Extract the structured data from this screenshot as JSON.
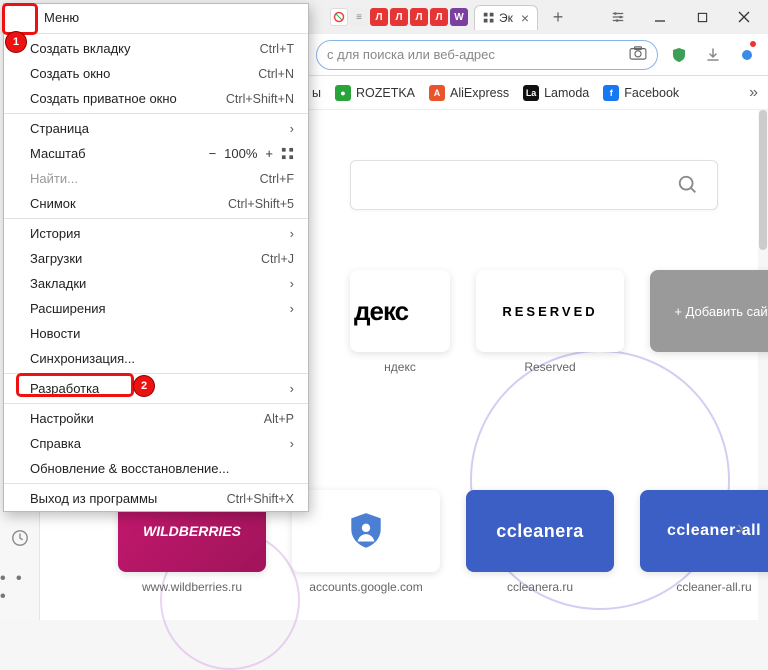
{
  "menu": {
    "title": "Меню",
    "items": [
      {
        "label": "Создать вкладку",
        "shortcut": "Ctrl+T"
      },
      {
        "label": "Создать окно",
        "shortcut": "Ctrl+N"
      },
      {
        "label": "Создать приватное окно",
        "shortcut": "Ctrl+Shift+N"
      }
    ],
    "page_item": {
      "label": "Страница"
    },
    "zoom_item": {
      "label": "Масштаб",
      "minus": "−",
      "value": "100%",
      "plus": "+"
    },
    "find_item": {
      "label": "Найти...",
      "shortcut": "Ctrl+F"
    },
    "snapshot_item": {
      "label": "Снимок",
      "shortcut": "Ctrl+Shift+5"
    },
    "history_item": {
      "label": "История"
    },
    "downloads_item": {
      "label": "Загрузки",
      "shortcut": "Ctrl+J"
    },
    "bookmarks_item": {
      "label": "Закладки"
    },
    "extensions_item": {
      "label": "Расширения"
    },
    "news_item": {
      "label": "Новости"
    },
    "sync_item": {
      "label": "Синхронизация..."
    },
    "dev_item": {
      "label": "Разработка"
    },
    "settings_item": {
      "label": "Настройки",
      "shortcut": "Alt+P"
    },
    "help_item": {
      "label": "Справка"
    },
    "update_item": {
      "label": "Обновление & восстановление..."
    },
    "exit_item": {
      "label": "Выход из программы",
      "shortcut": "Ctrl+Shift+X"
    }
  },
  "toolbar": {
    "url_placeholder": "с для поиска или веб-адрес"
  },
  "active_tab": {
    "label": "Эк"
  },
  "bookmarks": {
    "items": [
      {
        "label": "ы",
        "color": "#f0a030"
      },
      {
        "label": "ROZETKA",
        "color": "#2aa33a",
        "icon": "●"
      },
      {
        "label": "AliExpress",
        "color": "#e8542c",
        "icon": "A"
      },
      {
        "label": "Lamoda",
        "color": "#111",
        "icon": "La"
      },
      {
        "label": "Facebook",
        "color": "#1877f2",
        "icon": "f"
      }
    ]
  },
  "tiles_r1": [
    {
      "text": "декс",
      "label": "ндекс",
      "style": "yandex"
    },
    {
      "text": "RESERVED",
      "label": "Reserved",
      "style": "reserved"
    },
    {
      "text": "+ Добавить сайт",
      "label": "",
      "style": "add"
    }
  ],
  "tiles_r2": [
    {
      "text": "WILDBERRIES",
      "label": "www.wildberries.ru",
      "style": "wild"
    },
    {
      "text": "",
      "label": "accounts.google.com",
      "style": "google"
    },
    {
      "text": "ccleanera",
      "label": "ccleanera.ru",
      "style": "blue"
    },
    {
      "text": "ccleaner-all",
      "label": "ccleaner-all.ru",
      "style": "blue2"
    }
  ],
  "colors": {
    "red": "#e63535",
    "orange": "#f0a030",
    "purple": "#7b3fa0",
    "grey": "#9a9a9a"
  }
}
